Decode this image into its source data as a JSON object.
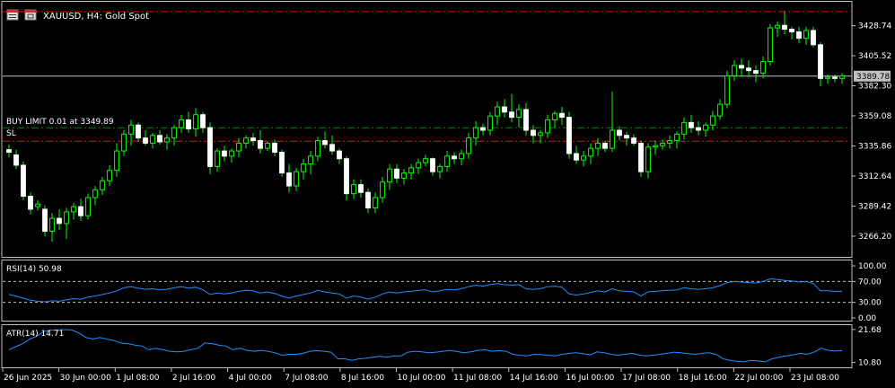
{
  "header": {
    "symbol_text": "XAUUSD, H4:  Gold Spot",
    "menu_icon": "chart-menu-icon",
    "window_icon": "window-restore-icon"
  },
  "colors": {
    "background": "#000000",
    "bull": "#00ff00",
    "bear": "#ffffff",
    "indicator_line": "#1e90ff",
    "order_line": "#008000",
    "sl_line": "#ff0000",
    "level_line": "#c0c0c0",
    "grid_text": "#ffffff"
  },
  "chart_data": [
    {
      "type": "candlestick",
      "title": "XAUUSD, H4:  Gold Spot",
      "y_ticks": [
        3428.74,
        3405.52,
        3382.3,
        3359.08,
        3335.86,
        3312.64,
        3289.42,
        3266.2
      ],
      "ylim": [
        3253,
        3443
      ],
      "current_price": 3389.78,
      "current_price_label": "3389.78",
      "order_line": {
        "price": 3349.89,
        "label": "BUY LIMIT 0.01 at 3349.89"
      },
      "sl_line": {
        "price": 3339.5,
        "label": "SL"
      },
      "top_line": {
        "price": 3439.5
      },
      "x_ticks": [
        "26 Jun 2025",
        "30 Jun 00:00",
        "1 Jul 08:00",
        "2 Jul 16:00",
        "4 Jul 00:00",
        "7 Jul 08:00",
        "8 Jul 16:00",
        "10 Jul 00:00",
        "11 Jul 08:00",
        "14 Jul 16:00",
        "16 Jul 00:00",
        "17 Jul 08:00",
        "18 Jul 16:00",
        "22 Jul 00:00",
        "23 Jul 08:00"
      ],
      "ohlc": [
        [
          3333,
          3337,
          3327,
          3331
        ],
        [
          3329,
          3333,
          3318,
          3321
        ],
        [
          3321,
          3324,
          3294,
          3297
        ],
        [
          3297,
          3300,
          3283,
          3287
        ],
        [
          3289,
          3294,
          3286,
          3291
        ],
        [
          3287,
          3290,
          3266,
          3270
        ],
        [
          3270,
          3284,
          3262,
          3280
        ],
        [
          3280,
          3287,
          3271,
          3276
        ],
        [
          3276,
          3288,
          3264,
          3285
        ],
        [
          3285,
          3292,
          3279,
          3289
        ],
        [
          3289,
          3295,
          3278,
          3282
        ],
        [
          3282,
          3299,
          3279,
          3296
        ],
        [
          3296,
          3305,
          3290,
          3302
        ],
        [
          3302,
          3312,
          3298,
          3309
        ],
        [
          3309,
          3321,
          3305,
          3317
        ],
        [
          3317,
          3338,
          3312,
          3332
        ],
        [
          3332,
          3348,
          3328,
          3345
        ],
        [
          3345,
          3356,
          3336,
          3352
        ],
        [
          3352,
          3354,
          3339,
          3342
        ],
        [
          3342,
          3348,
          3336,
          3338
        ],
        [
          3338,
          3346,
          3334,
          3344
        ],
        [
          3344,
          3348,
          3337,
          3339
        ],
        [
          3339,
          3345,
          3333,
          3342
        ],
        [
          3342,
          3352,
          3336,
          3350
        ],
        [
          3350,
          3360,
          3346,
          3356
        ],
        [
          3356,
          3362,
          3346,
          3349
        ],
        [
          3349,
          3365,
          3343,
          3360
        ],
        [
          3360,
          3362,
          3346,
          3350
        ],
        [
          3350,
          3354,
          3314,
          3320
        ],
        [
          3320,
          3334,
          3316,
          3332
        ],
        [
          3332,
          3336,
          3324,
          3328
        ],
        [
          3328,
          3334,
          3323,
          3332
        ],
        [
          3332,
          3342,
          3327,
          3338
        ],
        [
          3338,
          3344,
          3334,
          3342
        ],
        [
          3342,
          3346,
          3336,
          3340
        ],
        [
          3340,
          3348,
          3330,
          3334
        ],
        [
          3334,
          3339,
          3332,
          3338
        ],
        [
          3338,
          3341,
          3328,
          3331
        ],
        [
          3331,
          3333,
          3312,
          3315
        ],
        [
          3315,
          3322,
          3300,
          3305
        ],
        [
          3305,
          3319,
          3301,
          3316
        ],
        [
          3316,
          3326,
          3310,
          3322
        ],
        [
          3322,
          3332,
          3314,
          3328
        ],
        [
          3328,
          3343,
          3324,
          3340
        ],
        [
          3340,
          3347,
          3334,
          3337
        ],
        [
          3337,
          3344,
          3329,
          3332
        ],
        [
          3332,
          3334,
          3322,
          3326
        ],
        [
          3326,
          3328,
          3294,
          3299
        ],
        [
          3299,
          3310,
          3295,
          3306
        ],
        [
          3306,
          3310,
          3296,
          3300
        ],
        [
          3300,
          3303,
          3284,
          3288
        ],
        [
          3288,
          3300,
          3284,
          3296
        ],
        [
          3296,
          3312,
          3292,
          3308
        ],
        [
          3308,
          3322,
          3302,
          3318
        ],
        [
          3318,
          3322,
          3307,
          3311
        ],
        [
          3311,
          3318,
          3306,
          3315
        ],
        [
          3315,
          3322,
          3310,
          3319
        ],
        [
          3319,
          3326,
          3314,
          3323
        ],
        [
          3323,
          3329,
          3320,
          3326
        ],
        [
          3326,
          3327,
          3313,
          3316
        ],
        [
          3316,
          3322,
          3311,
          3320
        ],
        [
          3320,
          3332,
          3316,
          3328
        ],
        [
          3328,
          3331,
          3322,
          3326
        ],
        [
          3326,
          3333,
          3321,
          3330
        ],
        [
          3330,
          3346,
          3326,
          3342
        ],
        [
          3342,
          3355,
          3336,
          3350
        ],
        [
          3350,
          3353,
          3344,
          3348
        ],
        [
          3348,
          3362,
          3344,
          3359
        ],
        [
          3359,
          3370,
          3352,
          3366
        ],
        [
          3366,
          3372,
          3358,
          3362
        ],
        [
          3362,
          3376,
          3354,
          3358
        ],
        [
          3358,
          3368,
          3350,
          3364
        ],
        [
          3364,
          3369,
          3344,
          3348
        ],
        [
          3348,
          3352,
          3338,
          3344
        ],
        [
          3344,
          3348,
          3338,
          3346
        ],
        [
          3346,
          3360,
          3342,
          3356
        ],
        [
          3356,
          3363,
          3350,
          3361
        ],
        [
          3361,
          3366,
          3352,
          3358
        ],
        [
          3358,
          3362,
          3326,
          3330
        ],
        [
          3330,
          3336,
          3322,
          3325
        ],
        [
          3325,
          3332,
          3320,
          3328
        ],
        [
          3328,
          3338,
          3322,
          3334
        ],
        [
          3334,
          3342,
          3328,
          3338
        ],
        [
          3338,
          3340,
          3331,
          3334
        ],
        [
          3334,
          3378,
          3331,
          3348
        ],
        [
          3348,
          3351,
          3340,
          3344
        ],
        [
          3344,
          3347,
          3336,
          3342
        ],
        [
          3342,
          3345,
          3336,
          3338
        ],
        [
          3338,
          3340,
          3312,
          3316
        ],
        [
          3316,
          3338,
          3311,
          3335
        ],
        [
          3335,
          3340,
          3329,
          3336
        ],
        [
          3336,
          3341,
          3333,
          3338
        ],
        [
          3338,
          3344,
          3334,
          3340
        ],
        [
          3340,
          3347,
          3334,
          3345
        ],
        [
          3345,
          3358,
          3341,
          3354
        ],
        [
          3354,
          3360,
          3346,
          3350
        ],
        [
          3350,
          3355,
          3344,
          3348
        ],
        [
          3348,
          3354,
          3343,
          3352
        ],
        [
          3352,
          3363,
          3348,
          3359
        ],
        [
          3359,
          3372,
          3356,
          3368
        ],
        [
          3368,
          3394,
          3365,
          3390
        ],
        [
          3390,
          3402,
          3386,
          3398
        ],
        [
          3398,
          3403,
          3389,
          3396
        ],
        [
          3396,
          3402,
          3389,
          3394
        ],
        [
          3394,
          3398,
          3385,
          3392
        ],
        [
          3392,
          3405,
          3388,
          3401
        ],
        [
          3401,
          3430,
          3398,
          3427
        ],
        [
          3427,
          3432,
          3420,
          3429
        ],
        [
          3429,
          3440,
          3422,
          3426
        ],
        [
          3426,
          3428,
          3418,
          3424
        ],
        [
          3424,
          3428,
          3415,
          3419
        ],
        [
          3419,
          3428,
          3414,
          3425
        ],
        [
          3425,
          3428,
          3412,
          3414
        ],
        [
          3414,
          3416,
          3382,
          3388
        ],
        [
          3388,
          3391,
          3384,
          3389
        ],
        [
          3389,
          3391,
          3385,
          3388
        ],
        [
          3388,
          3392,
          3384,
          3390
        ]
      ]
    },
    {
      "type": "line",
      "title": "RSI(14) 50.98",
      "y_ticks": [
        100.0,
        70.0,
        30.0,
        0.0
      ],
      "y_tick_labels": [
        "100.00",
        "70.00",
        "30.00",
        "0.00"
      ],
      "ylim": [
        0,
        100
      ],
      "dashed_levels": [
        70,
        30
      ],
      "values": [
        45,
        42,
        38,
        34,
        32,
        31,
        33,
        32,
        35,
        37,
        36,
        40,
        42,
        45,
        48,
        52,
        58,
        60,
        57,
        55,
        56,
        54,
        55,
        58,
        60,
        57,
        59,
        54,
        45,
        48,
        46,
        48,
        51,
        53,
        52,
        48,
        50,
        47,
        42,
        38,
        42,
        45,
        48,
        53,
        50,
        48,
        46,
        38,
        42,
        40,
        36,
        40,
        46,
        50,
        48,
        50,
        51,
        53,
        54,
        50,
        52,
        55,
        54,
        56,
        60,
        63,
        61,
        64,
        66,
        64,
        63,
        64,
        56,
        55,
        56,
        60,
        61,
        59,
        46,
        44,
        46,
        49,
        52,
        50,
        56,
        52,
        51,
        50,
        42,
        50,
        51,
        52,
        53,
        54,
        58,
        56,
        55,
        56,
        58,
        62,
        68,
        70,
        69,
        68,
        67,
        70,
        75,
        74,
        72,
        71,
        69,
        70,
        66,
        52,
        52,
        51,
        51
      ]
    },
    {
      "type": "line",
      "title": "ATR(14) 14.71",
      "y_ticks": [
        21.68,
        10.8
      ],
      "y_tick_labels": [
        "21.68",
        "10.80"
      ],
      "ylim": [
        9.5,
        22.5
      ],
      "values": [
        15,
        16,
        17,
        18.5,
        19.5,
        21,
        21.5,
        21.5,
        21.6,
        21.5,
        20.5,
        19,
        18.5,
        19,
        18.5,
        18,
        17.2,
        17,
        16.5,
        16.2,
        15,
        15.5,
        15,
        14.5,
        14.3,
        14.5,
        15,
        15.5,
        17.2,
        17,
        16.5,
        16.2,
        15,
        15.5,
        14.8,
        14.5,
        14.8,
        14.5,
        14,
        13.2,
        13.5,
        13.5,
        13.8,
        14.5,
        14.7,
        14.5,
        14.2,
        12,
        12,
        11.5,
        12,
        12.2,
        12.5,
        12.8,
        12.5,
        13,
        13,
        14.2,
        14.5,
        14.3,
        14,
        14.2,
        14.5,
        14.8,
        14.4,
        14,
        14.3,
        14.8,
        15,
        14.5,
        14.7,
        14.5,
        13.5,
        13.2,
        13,
        13.5,
        13.4,
        13.2,
        13,
        13.5,
        13.8,
        14,
        13.7,
        13.3,
        14.3,
        14,
        13.5,
        13.2,
        13.5,
        13.8,
        13.3,
        13,
        13.2,
        13.5,
        13.8,
        14.2,
        14,
        13.7,
        13.5,
        13.8,
        14,
        13.5,
        12,
        11.5,
        11.2,
        11,
        11.5,
        11.3,
        11,
        12,
        12.5,
        13,
        13.3,
        13.8,
        13.5,
        14.2,
        15.5,
        14.8,
        14.6,
        14.71
      ]
    }
  ]
}
